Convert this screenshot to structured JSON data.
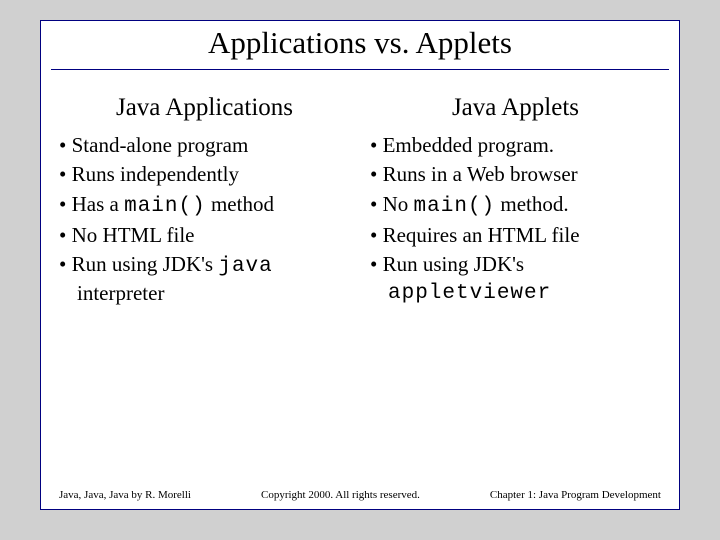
{
  "title": "Applications vs. Applets",
  "left": {
    "heading": "Java Applications",
    "items": [
      [
        {
          "t": "Stand-alone program"
        }
      ],
      [
        {
          "t": "Runs independently"
        }
      ],
      [
        {
          "t": "Has a "
        },
        {
          "t": "main()",
          "c": true
        },
        {
          "t": " method"
        }
      ],
      [
        {
          "t": "No HTML file"
        }
      ],
      [
        {
          "t": "Run using JDK's "
        },
        {
          "t": "java",
          "c": true
        },
        {
          "t": " interpreter"
        }
      ]
    ]
  },
  "right": {
    "heading": "Java Applets",
    "items": [
      [
        {
          "t": "Embedded program."
        }
      ],
      [
        {
          "t": "Runs in a Web browser"
        }
      ],
      [
        {
          "t": "No "
        },
        {
          "t": "main()",
          "c": true
        },
        {
          "t": " method."
        }
      ],
      [
        {
          "t": "Requires an HTML file"
        }
      ],
      [
        {
          "t": "Run using JDK's "
        },
        {
          "t": "appletviewer",
          "c": true
        }
      ]
    ]
  },
  "footer": {
    "left": "Java, Java, Java by R. Morelli",
    "center": "Copyright 2000. All rights reserved.",
    "right": "Chapter 1: Java Program Development"
  }
}
